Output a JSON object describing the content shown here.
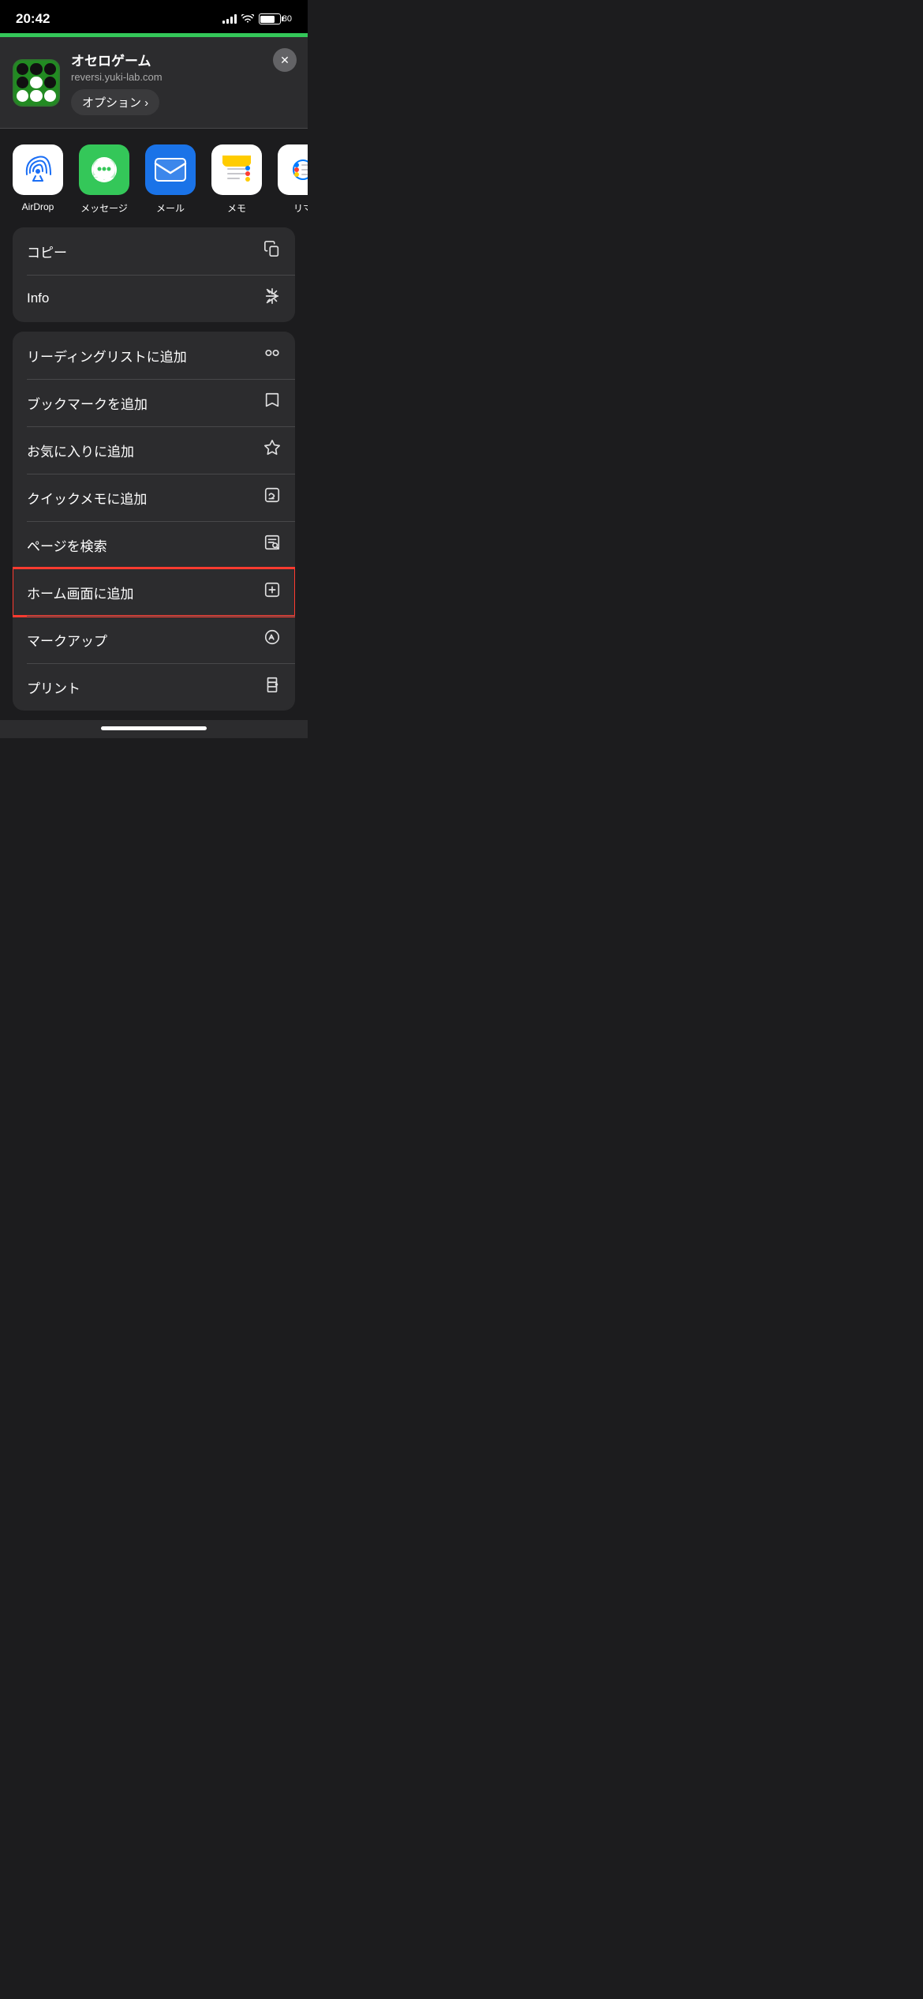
{
  "statusBar": {
    "time": "20:42",
    "battery": "80"
  },
  "shareHeader": {
    "appName": "オセロゲーム",
    "url": "reversi.yuki-lab.com",
    "optionsLabel": "オプション ›",
    "closeLabel": "×"
  },
  "appsRow": [
    {
      "id": "airdrop",
      "label": "AirDrop",
      "type": "airdrop"
    },
    {
      "id": "messages",
      "label": "メッセージ",
      "type": "messages"
    },
    {
      "id": "mail",
      "label": "メール",
      "type": "mail"
    },
    {
      "id": "notes",
      "label": "メモ",
      "type": "notes"
    },
    {
      "id": "reminder",
      "label": "リマ",
      "type": "reminder"
    }
  ],
  "menuSections": [
    {
      "id": "section1",
      "items": [
        {
          "id": "copy",
          "label": "コピー",
          "iconType": "copy"
        },
        {
          "id": "info",
          "label": "Info",
          "iconType": "info"
        }
      ]
    },
    {
      "id": "section2",
      "items": [
        {
          "id": "reading-list",
          "label": "リーディングリストに追加",
          "iconType": "reading-list"
        },
        {
          "id": "bookmark",
          "label": "ブックマークを追加",
          "iconType": "bookmark"
        },
        {
          "id": "favorites",
          "label": "お気に入りに追加",
          "iconType": "favorites"
        },
        {
          "id": "quick-note",
          "label": "クイックメモに追加",
          "iconType": "quick-note"
        },
        {
          "id": "find-on-page",
          "label": "ページを検索",
          "iconType": "find-on-page"
        },
        {
          "id": "add-to-home",
          "label": "ホーム画面に追加",
          "iconType": "add-to-home",
          "highlighted": true
        },
        {
          "id": "markup",
          "label": "マークアップ",
          "iconType": "markup"
        },
        {
          "id": "print",
          "label": "プリント",
          "iconType": "print"
        }
      ]
    }
  ]
}
